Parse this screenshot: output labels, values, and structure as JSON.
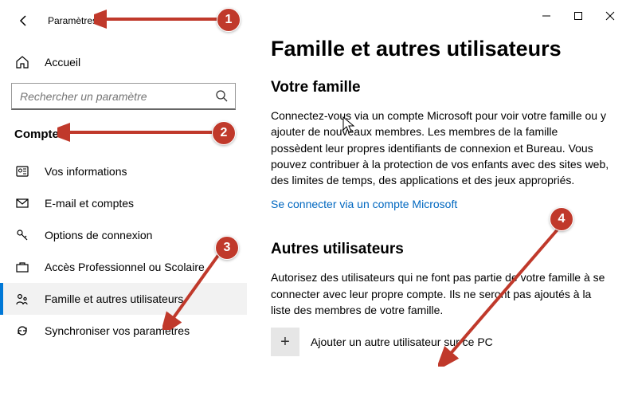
{
  "sidebar": {
    "back_title": "Paramètres",
    "home": "Accueil",
    "search_placeholder": "Rechercher un paramètre",
    "section": "Comptes",
    "items": [
      {
        "icon": "user",
        "label": "Vos informations"
      },
      {
        "icon": "mail",
        "label": "E-mail et comptes"
      },
      {
        "icon": "key",
        "label": "Options de connexion"
      },
      {
        "icon": "briefcase",
        "label": "Accès Professionnel ou Scolaire"
      },
      {
        "icon": "family",
        "label": "Famille et autres utilisateurs"
      },
      {
        "icon": "sync",
        "label": "Synchroniser vos paramètres"
      }
    ]
  },
  "content": {
    "page_title": "Famille et autres utilisateurs",
    "family": {
      "heading": "Votre famille",
      "body": "Connectez-vous via un compte Microsoft pour voir votre famille ou y ajouter de nouveaux membres. Les membres de la famille possèdent leur propres identifiants de connexion et Bureau. Vous pouvez contribuer à la protection de vos enfants avec des sites web, des limites de temps, des applications et des jeux appropriés.",
      "link": "Se connecter via un compte Microsoft"
    },
    "others": {
      "heading": "Autres utilisateurs",
      "body": "Autorisez des utilisateurs qui ne font pas partie de votre famille à se connecter avec leur propre compte. Ils ne seront pas ajoutés à la liste des membres de votre famille.",
      "add_label": "Ajouter un autre utilisateur sur ce PC"
    }
  },
  "annotations": {
    "b1": "1",
    "b2": "2",
    "b3": "3",
    "b4": "4"
  }
}
